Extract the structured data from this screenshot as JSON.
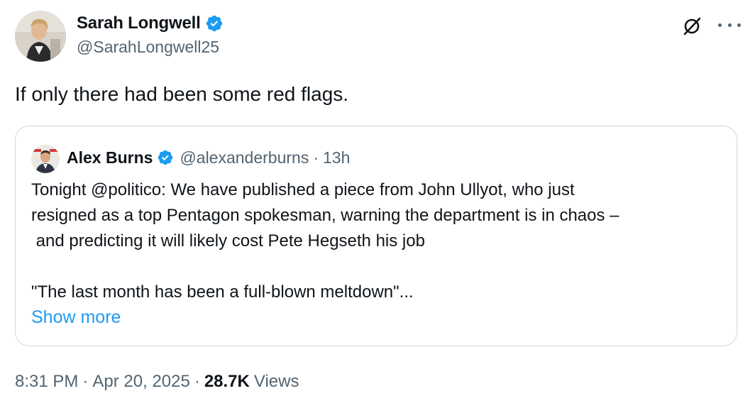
{
  "author": {
    "name": "Sarah Longwell",
    "handle": "@SarahLongwell25",
    "verified": true
  },
  "icons": {
    "verified": "verified-badge-icon",
    "grok": "grok-icon",
    "more": "more-options-icon"
  },
  "colors": {
    "verified_blue": "#1d9bf0",
    "link_blue": "#1d9bf0",
    "secondary_text": "#536471",
    "primary_text": "#0f1419",
    "border": "#cfd9de"
  },
  "tweet": {
    "text": "If only there had been some red flags."
  },
  "quote": {
    "name": "Alex Burns",
    "handle": "@alexanderburns",
    "separator": "·",
    "time": "13h",
    "body_lines": [
      "Tonight @politico: We have published a piece from John Ullyot, who just",
      "resigned as a top Pentagon spokesman, warning the department is in chaos –",
      " and predicting it will likely cost Pete Hegseth his job",
      "\"The last month has been a full-blown meltdown\"..."
    ],
    "show_more": "Show more"
  },
  "footer": {
    "time": "8:31 PM",
    "separator": "·",
    "date": "Apr 20, 2025",
    "views_count": "28.7K",
    "views_label": "Views"
  }
}
